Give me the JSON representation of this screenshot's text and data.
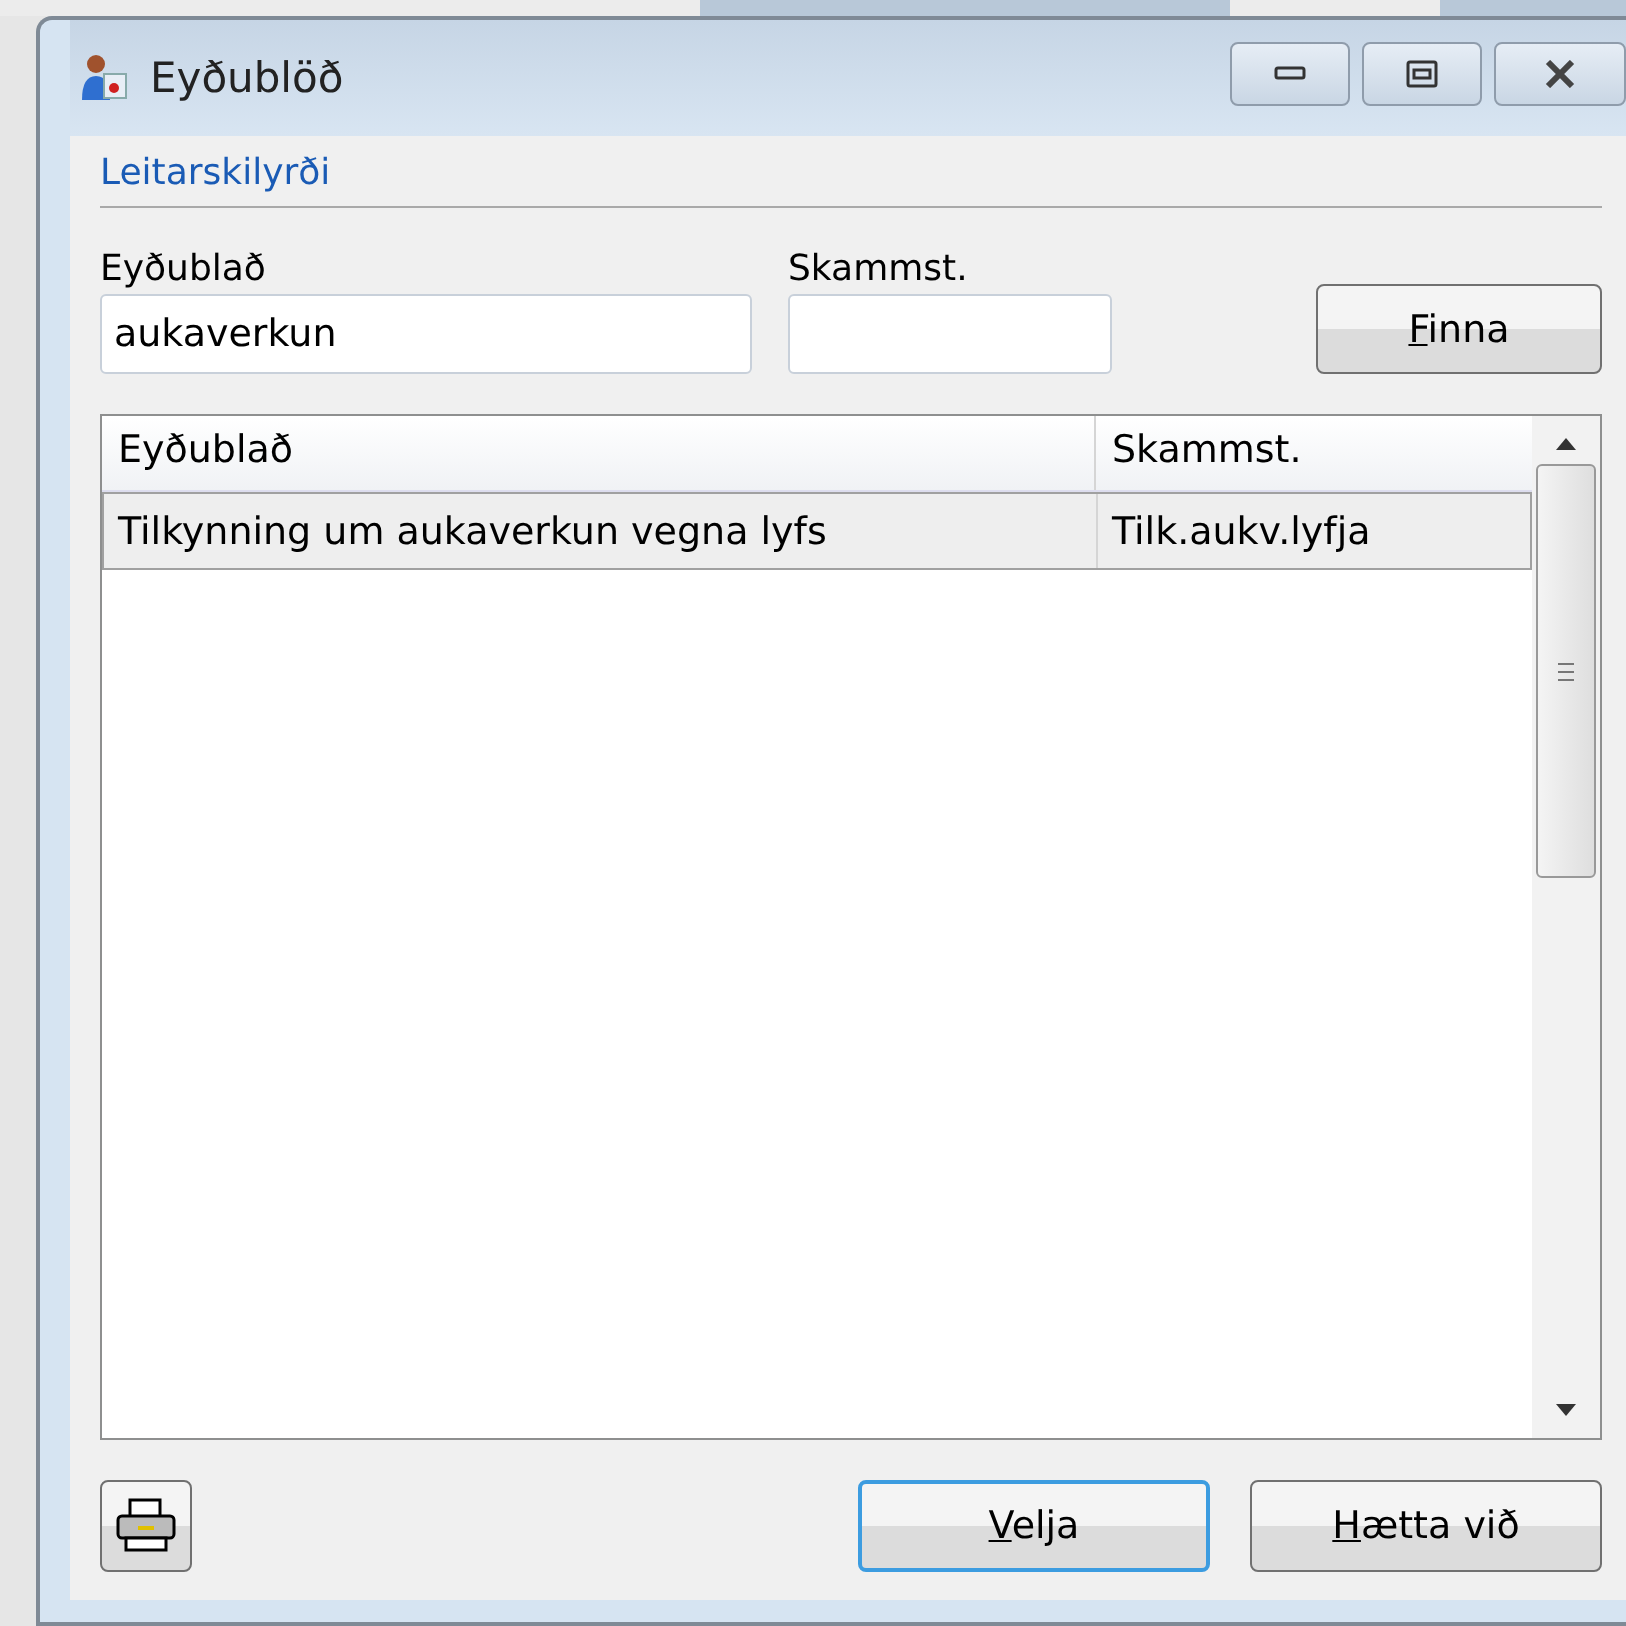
{
  "window": {
    "title": "Eyðublöð"
  },
  "search": {
    "group_label": "Leitarskilyrði",
    "fields": [
      {
        "label": "Eyðublað",
        "value": "aukaverkun"
      },
      {
        "label": "Skammst."
      }
    ],
    "button": "Finna"
  },
  "table": {
    "columns": [
      "Eyðublað",
      "Skammst."
    ],
    "rows": [
      {
        "cells": [
          "Tilkynning um aukaverkun vegna lyfs",
          "Tilk.aukv.lyfja"
        ],
        "selected": true
      }
    ]
  },
  "buttons": [
    {
      "label": "Velja",
      "focused": true
    },
    {
      "label": "Hætta við",
      "focused": false
    }
  ]
}
